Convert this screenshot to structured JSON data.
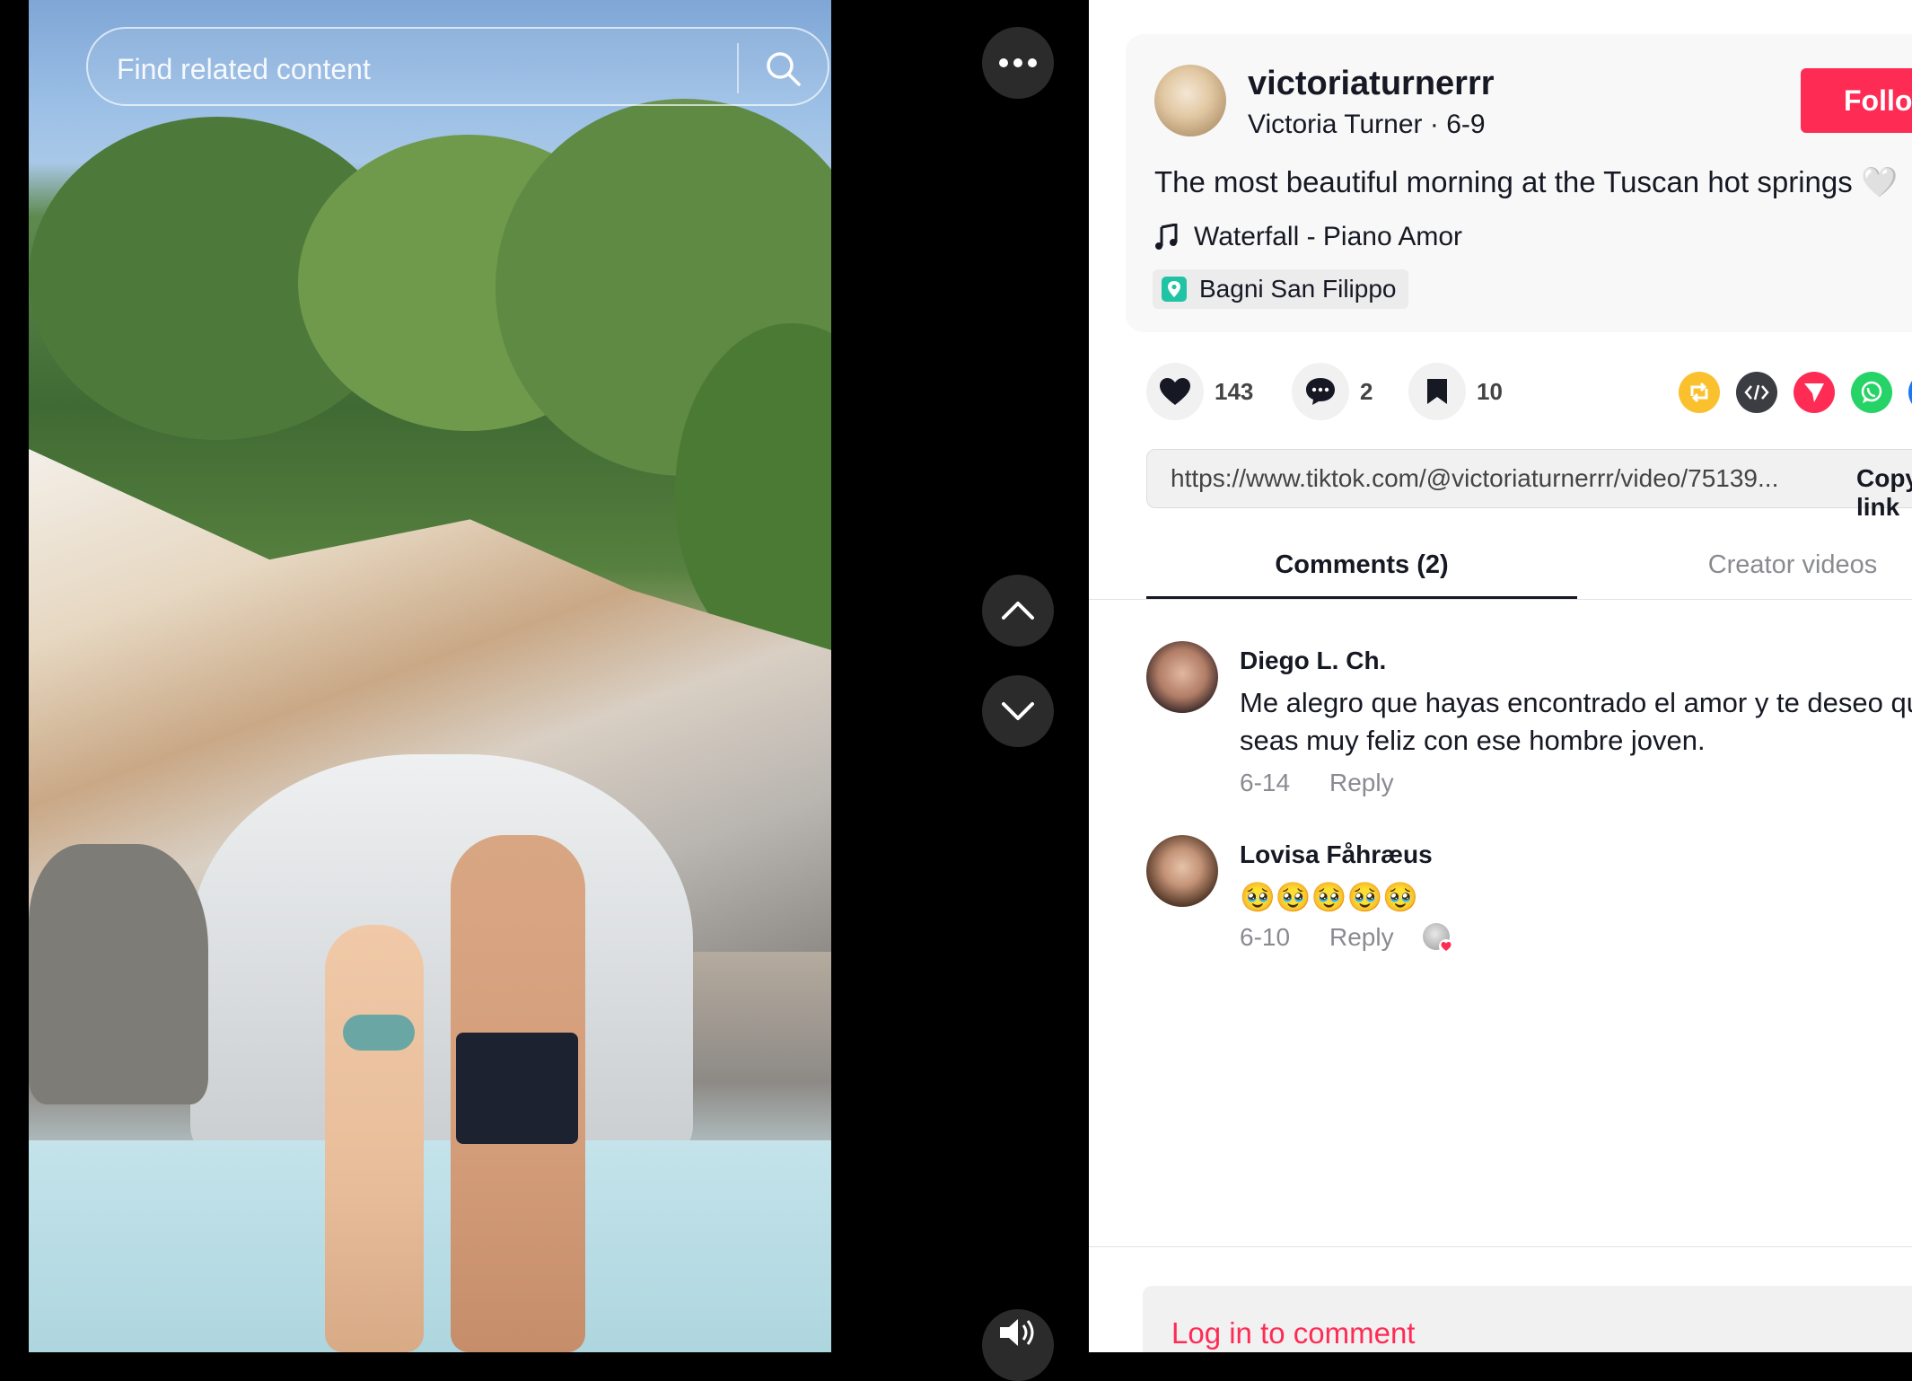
{
  "search": {
    "placeholder": "Find related content"
  },
  "post": {
    "author_username": "victoriaturnerrr",
    "author_name": "Victoria Turner",
    "separator": "·",
    "date": "6-9",
    "follow_label": "Follow",
    "caption": "The most beautiful morning at the Tuscan hot springs",
    "caption_emoji": "🤍",
    "music": "Waterfall - Piano Amor",
    "location": "Bagni San Filippo"
  },
  "actions": {
    "likes": "143",
    "comments": "2",
    "saves": "10"
  },
  "share": {
    "icons": [
      "repost-icon",
      "embed-icon",
      "send-icon",
      "whatsapp-icon"
    ],
    "colors": {
      "repost": "#fbc02d",
      "embed": "#3c3c43",
      "send": "#fe2c55",
      "whatsapp": "#25d366"
    }
  },
  "link": {
    "url": "https://www.tiktok.com/@victoriaturnerrr/video/75139...",
    "copy_label": "Copy link"
  },
  "tabs": [
    {
      "label": "Comments (2)",
      "active": true
    },
    {
      "label": "Creator videos",
      "active": false
    }
  ],
  "comments": [
    {
      "author": "Diego L. Ch.",
      "text": "Me alegro que hayas encontrado el amor y te deseo que seas muy feliz con ese hombre joven.",
      "date": "6-14",
      "reply_label": "Reply"
    },
    {
      "author": "Lovisa Fåhræus",
      "text": "🥹🥹🥹🥹🥹",
      "date": "6-10",
      "reply_label": "Reply",
      "liked_by_creator": true
    }
  ],
  "comment_input": {
    "login_prompt": "Log in to comment"
  },
  "colors": {
    "accent": "#fe2c55",
    "text": "#161823",
    "muted": "#8a8b91"
  }
}
